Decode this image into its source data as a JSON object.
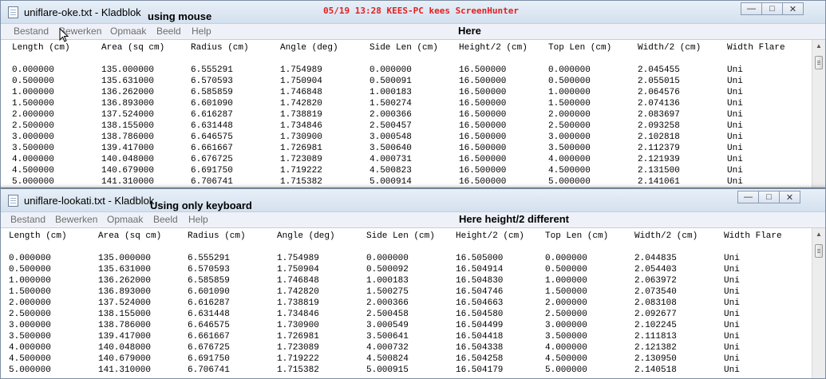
{
  "stamp": "05/19 13:28 KEES-PC kees ScreenHunter",
  "windows": [
    {
      "title": "uniflare-oke.txt - Kladblok",
      "annotation": "using mouse",
      "menu": [
        "Bestand",
        "Bewerken",
        "Opmaak",
        "Beeld",
        "Help"
      ],
      "menu_note": "Here",
      "controls": [
        "minimize",
        "maximize",
        "close"
      ],
      "header": [
        "Length (cm)",
        "Area (sq cm)",
        "Radius (cm)",
        "Angle (deg)",
        "Side Len (cm)",
        "Height/2 (cm)",
        "Top Len (cm)",
        "Width/2 (cm)",
        "Width Flare"
      ],
      "rows": [
        [
          "0.000000",
          "135.000000",
          "6.555291",
          "1.754989",
          "0.000000",
          "16.500000",
          "0.000000",
          "2.045455",
          "Uni"
        ],
        [
          "0.500000",
          "135.631000",
          "6.570593",
          "1.750904",
          "0.500091",
          "16.500000",
          "0.500000",
          "2.055015",
          "Uni"
        ],
        [
          "1.000000",
          "136.262000",
          "6.585859",
          "1.746848",
          "1.000183",
          "16.500000",
          "1.000000",
          "2.064576",
          "Uni"
        ],
        [
          "1.500000",
          "136.893000",
          "6.601090",
          "1.742820",
          "1.500274",
          "16.500000",
          "1.500000",
          "2.074136",
          "Uni"
        ],
        [
          "2.000000",
          "137.524000",
          "6.616287",
          "1.738819",
          "2.000366",
          "16.500000",
          "2.000000",
          "2.083697",
          "Uni"
        ],
        [
          "2.500000",
          "138.155000",
          "6.631448",
          "1.734846",
          "2.500457",
          "16.500000",
          "2.500000",
          "2.093258",
          "Uni"
        ],
        [
          "3.000000",
          "138.786000",
          "6.646575",
          "1.730900",
          "3.000548",
          "16.500000",
          "3.000000",
          "2.102818",
          "Uni"
        ],
        [
          "3.500000",
          "139.417000",
          "6.661667",
          "1.726981",
          "3.500640",
          "16.500000",
          "3.500000",
          "2.112379",
          "Uni"
        ],
        [
          "4.000000",
          "140.048000",
          "6.676725",
          "1.723089",
          "4.000731",
          "16.500000",
          "4.000000",
          "2.121939",
          "Uni"
        ],
        [
          "4.500000",
          "140.679000",
          "6.691750",
          "1.719222",
          "4.500823",
          "16.500000",
          "4.500000",
          "2.131500",
          "Uni"
        ],
        [
          "5.000000",
          "141.310000",
          "6.706741",
          "1.715382",
          "5.000914",
          "16.500000",
          "5.000000",
          "2.141061",
          "Uni"
        ]
      ]
    },
    {
      "title": "uniflare-lookati.txt - Kladblok",
      "annotation": "Using only keyboard",
      "menu": [
        "Bestand",
        "Bewerken",
        "Opmaak",
        "Beeld",
        "Help"
      ],
      "menu_note": "Here height/2 different",
      "controls": [
        "minimize",
        "maximize",
        "close"
      ],
      "header": [
        "Length (cm)",
        "Area (sq cm)",
        "Radius (cm)",
        "Angle (deg)",
        "Side Len (cm)",
        "Height/2 (cm)",
        "Top Len (cm)",
        "Width/2 (cm)",
        "Width Flare"
      ],
      "rows": [
        [
          "0.000000",
          "135.000000",
          "6.555291",
          "1.754989",
          "0.000000",
          "16.505000",
          "0.000000",
          "2.044835",
          "Uni"
        ],
        [
          "0.500000",
          "135.631000",
          "6.570593",
          "1.750904",
          "0.500092",
          "16.504914",
          "0.500000",
          "2.054403",
          "Uni"
        ],
        [
          "1.000000",
          "136.262000",
          "6.585859",
          "1.746848",
          "1.000183",
          "16.504830",
          "1.000000",
          "2.063972",
          "Uni"
        ],
        [
          "1.500000",
          "136.893000",
          "6.601090",
          "1.742820",
          "1.500275",
          "16.504746",
          "1.500000",
          "2.073540",
          "Uni"
        ],
        [
          "2.000000",
          "137.524000",
          "6.616287",
          "1.738819",
          "2.000366",
          "16.504663",
          "2.000000",
          "2.083108",
          "Uni"
        ],
        [
          "2.500000",
          "138.155000",
          "6.631448",
          "1.734846",
          "2.500458",
          "16.504580",
          "2.500000",
          "2.092677",
          "Uni"
        ],
        [
          "3.000000",
          "138.786000",
          "6.646575",
          "1.730900",
          "3.000549",
          "16.504499",
          "3.000000",
          "2.102245",
          "Uni"
        ],
        [
          "3.500000",
          "139.417000",
          "6.661667",
          "1.726981",
          "3.500641",
          "16.504418",
          "3.500000",
          "2.111813",
          "Uni"
        ],
        [
          "4.000000",
          "140.048000",
          "6.676725",
          "1.723089",
          "4.000732",
          "16.504338",
          "4.000000",
          "2.121382",
          "Uni"
        ],
        [
          "4.500000",
          "140.679000",
          "6.691750",
          "1.719222",
          "4.500824",
          "16.504258",
          "4.500000",
          "2.130950",
          "Uni"
        ],
        [
          "5.000000",
          "141.310000",
          "6.706741",
          "1.715382",
          "5.000915",
          "16.504179",
          "5.000000",
          "2.140518",
          "Uni"
        ]
      ]
    }
  ]
}
